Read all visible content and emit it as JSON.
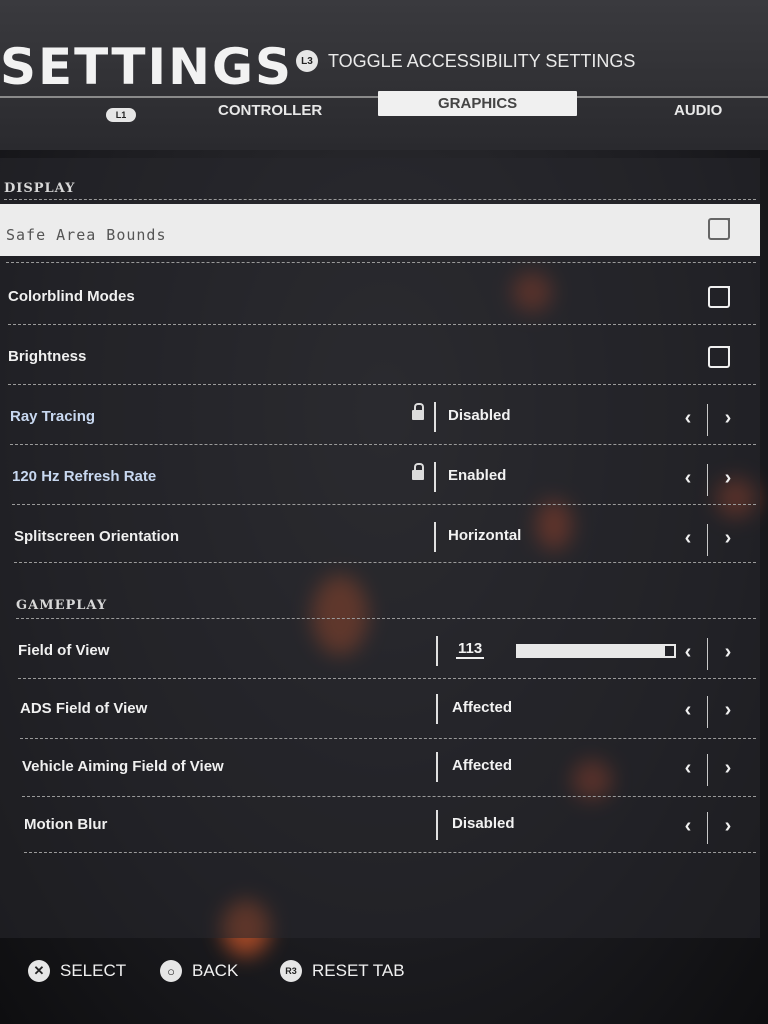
{
  "header": {
    "title": "SETTINGS",
    "accessibility_button": "L3",
    "accessibility_label": "TOGGLE ACCESSIBILITY SETTINGS",
    "tab_prev_button": "L1",
    "tabs": [
      {
        "label": "CONTROLLER",
        "active": false
      },
      {
        "label": "GRAPHICS",
        "active": true
      },
      {
        "label": "AUDIO",
        "active": false
      }
    ]
  },
  "sections": {
    "display_title": "DISPLAY",
    "gameplay_title": "GAMEPLAY"
  },
  "display": {
    "safe_area": {
      "label": "Safe Area Bounds",
      "icon": "external-link-icon"
    },
    "colorblind": {
      "label": "Colorblind Modes",
      "icon": "external-link-icon"
    },
    "brightness": {
      "label": "Brightness",
      "icon": "external-link-icon"
    },
    "ray_tracing": {
      "label": "Ray Tracing",
      "value": "Disabled",
      "locked": true
    },
    "refresh_rate": {
      "label": "120 Hz Refresh Rate",
      "value": "Enabled",
      "locked": true
    },
    "splitscreen": {
      "label": "Splitscreen Orientation",
      "value": "Horizontal",
      "locked": false
    }
  },
  "gameplay": {
    "fov": {
      "label": "Field of View",
      "value": "113",
      "slider_fraction": 0.94
    },
    "ads_fov": {
      "label": "ADS Field of View",
      "value": "Affected"
    },
    "vehicle_fov": {
      "label": "Vehicle Aiming Field of View",
      "value": "Affected"
    },
    "motion_blur": {
      "label": "Motion Blur",
      "value": "Disabled"
    }
  },
  "arrows": {
    "left": "‹",
    "right": "›"
  },
  "footer": {
    "select_icon": "✕",
    "select_label": "SELECT",
    "back_icon": "○",
    "back_label": "BACK",
    "reset_icon": "R3",
    "reset_label": "RESET TAB"
  },
  "colors": {
    "highlight_row": "#ececec",
    "locked_label": "#c8d8f0",
    "accent_glow": "#ff6a2a"
  }
}
